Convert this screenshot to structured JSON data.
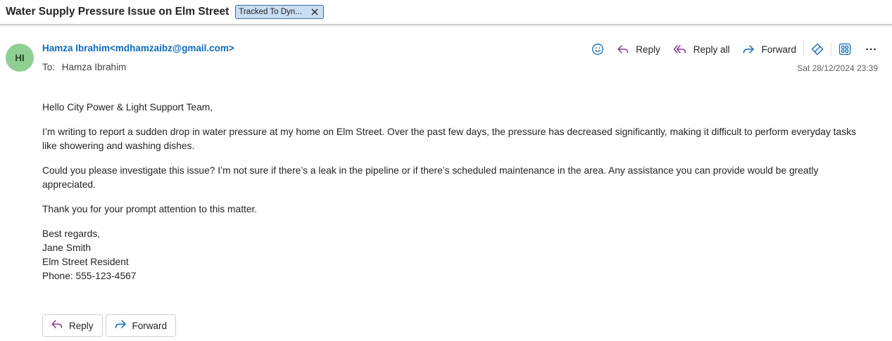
{
  "header": {
    "subject": "Water Supply Pressure Issue on Elm Street",
    "tag_label": "Tracked To Dyn..."
  },
  "message": {
    "avatar_initials": "HI",
    "sender": "Hamza Ibrahim<mdhamzaibz@gmail.com>",
    "to_label": "To:",
    "to_name": "Hamza Ibrahim",
    "date": "Sat 28/12/2024 23:39"
  },
  "actions": {
    "reply": "Reply",
    "reply_all": "Reply all",
    "forward": "Forward"
  },
  "body": {
    "greeting": "Hello City Power & Light Support Team,",
    "p1": "I’m writing to report a sudden drop in water pressure at my home on Elm Street. Over the past few days, the pressure has decreased significantly, making it difficult to perform everyday tasks like showering and washing dishes.",
    "p2": "Could you please investigate this issue? I’m not sure if there’s a leak in the pipeline or if there’s scheduled maintenance in the area. Any assistance you can provide would be greatly appreciated.",
    "p3": "Thank you for your prompt attention to this matter.",
    "closing": "Best regards,",
    "sig_name": "Jane Smith",
    "sig_title": "Elm Street Resident",
    "sig_phone": "Phone: 555-123-4567"
  },
  "bottom": {
    "reply": "Reply",
    "forward": "Forward"
  },
  "colors": {
    "accent": "#0f6cbd",
    "reply_icon": "#8b3a8f",
    "forward_icon": "#0f6cbd",
    "avatar_bg": "#8fcf94",
    "tag_bg": "#c9ddf1"
  }
}
